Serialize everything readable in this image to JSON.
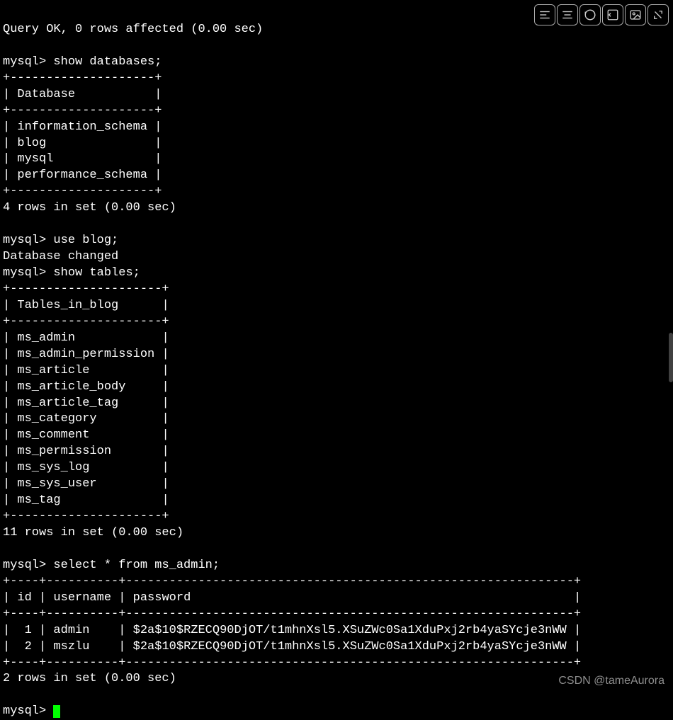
{
  "toolbar": {
    "icons": [
      "align-left-icon",
      "align-center-icon",
      "refresh-icon",
      "code-icon",
      "image-icon",
      "fullscreen-icon"
    ]
  },
  "watermark": "CSDN @tameAurora",
  "terminal": {
    "prompt": "mysql>",
    "query_ok_line": "Query OK, 0 rows affected (0.00 sec)",
    "commands": {
      "show_databases": "show databases;",
      "use_blog": "use blog;",
      "db_changed": "Database changed",
      "show_tables": "show tables;",
      "select_admin": "select * from ms_admin;"
    },
    "databases_table": {
      "header": "Database",
      "rows": [
        "information_schema",
        "blog",
        "mysql",
        "performance_schema"
      ],
      "footer": "4 rows in set (0.00 sec)"
    },
    "tables_table": {
      "header": "Tables_in_blog",
      "rows": [
        "ms_admin",
        "ms_admin_permission",
        "ms_article",
        "ms_article_body",
        "ms_article_tag",
        "ms_category",
        "ms_comment",
        "ms_permission",
        "ms_sys_log",
        "ms_sys_user",
        "ms_tag"
      ],
      "footer": "11 rows in set (0.00 sec)"
    },
    "admin_table": {
      "headers": [
        "id",
        "username",
        "password"
      ],
      "rows": [
        {
          "id": "1",
          "username": "admin",
          "password": "$2a$10$RZECQ90DjOT/t1mhnXsl5.XSuZWc0Sa1XduPxj2rb4yaSYcje3nWW"
        },
        {
          "id": "2",
          "username": "mszlu",
          "password": "$2a$10$RZECQ90DjOT/t1mhnXsl5.XSuZWc0Sa1XduPxj2rb4yaSYcje3nWW"
        }
      ],
      "footer": "2 rows in set (0.00 sec)"
    }
  }
}
